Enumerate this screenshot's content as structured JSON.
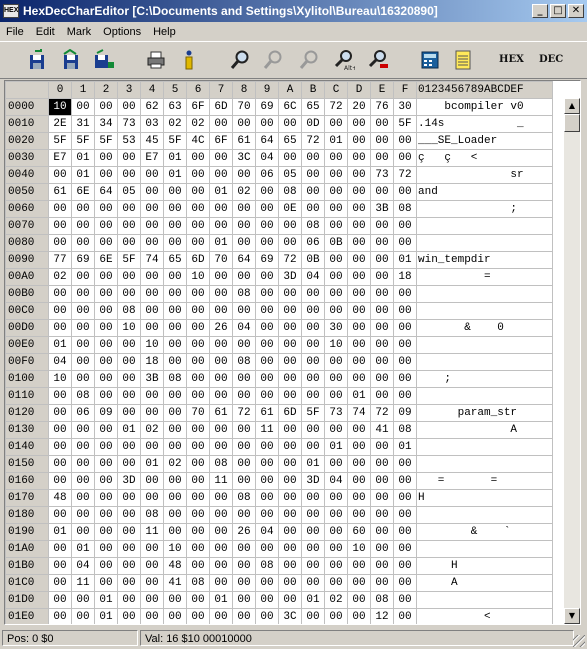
{
  "window": {
    "title": "HexDecCharEditor [C:\\Documents and Settings\\Xylitol\\Bureau\\16320890]",
    "minimize": "_",
    "maximize": "□",
    "close": "✕"
  },
  "menu": [
    "File",
    "Edit",
    "Mark",
    "Options",
    "Help"
  ],
  "toolbar": {
    "icons": [
      "save-icon",
      "save-all-icon",
      "save-selection-icon",
      "print-icon",
      "info-icon",
      "find-icon",
      "find-next-icon",
      "find-previous-icon",
      "find-replace-icon",
      "replace-icon",
      "calculator-icon",
      "notepad-icon"
    ],
    "hex_label": "HEX",
    "dec_label": "DEC"
  },
  "grid": {
    "corner": "",
    "columns": [
      "0",
      "1",
      "2",
      "3",
      "4",
      "5",
      "6",
      "7",
      "8",
      "9",
      "A",
      "B",
      "C",
      "D",
      "E",
      "F"
    ],
    "char_header": "0123456789ABCDEF",
    "selected": {
      "row": 0,
      "col": 0
    },
    "rows": [
      {
        "addr": "0000",
        "bytes": [
          "10",
          "00",
          "00",
          "00",
          "62",
          "63",
          "6F",
          "6D",
          "70",
          "69",
          "6C",
          "65",
          "72",
          "20",
          "76",
          "30"
        ],
        "text": "    bcompiler v0"
      },
      {
        "addr": "0010",
        "bytes": [
          "2E",
          "31",
          "34",
          "73",
          "03",
          "02",
          "02",
          "00",
          "00",
          "00",
          "00",
          "0D",
          "00",
          "00",
          "00",
          "5F"
        ],
        "text": ".14s           _"
      },
      {
        "addr": "0020",
        "bytes": [
          "5F",
          "5F",
          "5F",
          "53",
          "45",
          "5F",
          "4C",
          "6F",
          "61",
          "64",
          "65",
          "72",
          "01",
          "00",
          "00",
          "00"
        ],
        "text": "___SE_Loader    "
      },
      {
        "addr": "0030",
        "bytes": [
          "E7",
          "01",
          "00",
          "00",
          "E7",
          "01",
          "00",
          "00",
          "3C",
          "04",
          "00",
          "00",
          "00",
          "00",
          "00",
          "00"
        ],
        "text": "ç   ç   <       "
      },
      {
        "addr": "0040",
        "bytes": [
          "00",
          "01",
          "00",
          "00",
          "00",
          "01",
          "00",
          "00",
          "00",
          "06",
          "05",
          "00",
          "00",
          "00",
          "73",
          "72"
        ],
        "text": "              sr"
      },
      {
        "addr": "0050",
        "bytes": [
          "61",
          "6E",
          "64",
          "05",
          "00",
          "00",
          "00",
          "01",
          "02",
          "00",
          "08",
          "00",
          "00",
          "00",
          "00",
          "00"
        ],
        "text": "and             "
      },
      {
        "addr": "0060",
        "bytes": [
          "00",
          "00",
          "00",
          "00",
          "00",
          "00",
          "00",
          "00",
          "00",
          "00",
          "0E",
          "00",
          "00",
          "00",
          "3B",
          "08"
        ],
        "text": "              ; "
      },
      {
        "addr": "0070",
        "bytes": [
          "00",
          "00",
          "00",
          "00",
          "00",
          "00",
          "00",
          "00",
          "00",
          "00",
          "00",
          "08",
          "00",
          "00",
          "00",
          "00"
        ],
        "text": "                "
      },
      {
        "addr": "0080",
        "bytes": [
          "00",
          "00",
          "00",
          "00",
          "00",
          "00",
          "00",
          "01",
          "00",
          "00",
          "00",
          "06",
          "0B",
          "00",
          "00",
          "00"
        ],
        "text": "                "
      },
      {
        "addr": "0090",
        "bytes": [
          "77",
          "69",
          "6E",
          "5F",
          "74",
          "65",
          "6D",
          "70",
          "64",
          "69",
          "72",
          "0B",
          "00",
          "00",
          "00",
          "01"
        ],
        "text": "win_tempdir     "
      },
      {
        "addr": "00A0",
        "bytes": [
          "02",
          "00",
          "00",
          "00",
          "00",
          "00",
          "10",
          "00",
          "00",
          "00",
          "3D",
          "04",
          "00",
          "00",
          "00",
          "18"
        ],
        "text": "          =     "
      },
      {
        "addr": "00B0",
        "bytes": [
          "00",
          "00",
          "00",
          "00",
          "00",
          "00",
          "00",
          "00",
          "08",
          "00",
          "00",
          "00",
          "00",
          "00",
          "00",
          "00"
        ],
        "text": "                "
      },
      {
        "addr": "00C0",
        "bytes": [
          "00",
          "00",
          "00",
          "08",
          "00",
          "00",
          "00",
          "00",
          "00",
          "00",
          "00",
          "00",
          "00",
          "00",
          "00",
          "00"
        ],
        "text": "                "
      },
      {
        "addr": "00D0",
        "bytes": [
          "00",
          "00",
          "00",
          "10",
          "00",
          "00",
          "00",
          "26",
          "04",
          "00",
          "00",
          "00",
          "30",
          "00",
          "00",
          "00"
        ],
        "text": "       &    0   "
      },
      {
        "addr": "00E0",
        "bytes": [
          "01",
          "00",
          "00",
          "00",
          "10",
          "00",
          "00",
          "00",
          "00",
          "00",
          "00",
          "00",
          "10",
          "00",
          "00",
          "00"
        ],
        "text": "                "
      },
      {
        "addr": "00F0",
        "bytes": [
          "04",
          "00",
          "00",
          "00",
          "18",
          "00",
          "00",
          "00",
          "08",
          "00",
          "00",
          "00",
          "00",
          "00",
          "00",
          "00"
        ],
        "text": "                "
      },
      {
        "addr": "0100",
        "bytes": [
          "10",
          "00",
          "00",
          "00",
          "3B",
          "08",
          "00",
          "00",
          "00",
          "00",
          "00",
          "00",
          "00",
          "00",
          "00",
          "00"
        ],
        "text": "    ;           "
      },
      {
        "addr": "0110",
        "bytes": [
          "00",
          "08",
          "00",
          "00",
          "00",
          "00",
          "00",
          "00",
          "00",
          "00",
          "00",
          "00",
          "00",
          "01",
          "00",
          "00"
        ],
        "text": "                "
      },
      {
        "addr": "0120",
        "bytes": [
          "00",
          "06",
          "09",
          "00",
          "00",
          "00",
          "70",
          "61",
          "72",
          "61",
          "6D",
          "5F",
          "73",
          "74",
          "72",
          "09"
        ],
        "text": "      param_str "
      },
      {
        "addr": "0130",
        "bytes": [
          "00",
          "00",
          "00",
          "01",
          "02",
          "00",
          "00",
          "00",
          "00",
          "11",
          "00",
          "00",
          "00",
          "00",
          "41",
          "08"
        ],
        "text": "              A "
      },
      {
        "addr": "0140",
        "bytes": [
          "00",
          "00",
          "00",
          "00",
          "00",
          "00",
          "00",
          "00",
          "00",
          "00",
          "00",
          "00",
          "01",
          "00",
          "00",
          "01"
        ],
        "text": "                "
      },
      {
        "addr": "0150",
        "bytes": [
          "00",
          "00",
          "00",
          "00",
          "01",
          "02",
          "00",
          "08",
          "00",
          "00",
          "00",
          "01",
          "00",
          "00",
          "00",
          "00"
        ],
        "text": "                "
      },
      {
        "addr": "0160",
        "bytes": [
          "00",
          "00",
          "00",
          "3D",
          "00",
          "00",
          "00",
          "11",
          "00",
          "00",
          "00",
          "3D",
          "04",
          "00",
          "00",
          "00"
        ],
        "text": "   =       =    "
      },
      {
        "addr": "0170",
        "bytes": [
          "48",
          "00",
          "00",
          "00",
          "00",
          "00",
          "00",
          "00",
          "08",
          "00",
          "00",
          "00",
          "00",
          "00",
          "00",
          "00"
        ],
        "text": "H               "
      },
      {
        "addr": "0180",
        "bytes": [
          "00",
          "00",
          "00",
          "00",
          "08",
          "00",
          "00",
          "00",
          "00",
          "00",
          "00",
          "00",
          "00",
          "00",
          "00",
          "00"
        ],
        "text": "                "
      },
      {
        "addr": "0190",
        "bytes": [
          "01",
          "00",
          "00",
          "00",
          "11",
          "00",
          "00",
          "00",
          "26",
          "04",
          "00",
          "00",
          "00",
          "60",
          "00",
          "00"
        ],
        "text": "        &    `  "
      },
      {
        "addr": "01A0",
        "bytes": [
          "00",
          "01",
          "00",
          "00",
          "00",
          "10",
          "00",
          "00",
          "00",
          "00",
          "00",
          "00",
          "00",
          "10",
          "00",
          "00"
        ],
        "text": "                "
      },
      {
        "addr": "01B0",
        "bytes": [
          "00",
          "04",
          "00",
          "00",
          "00",
          "48",
          "00",
          "00",
          "00",
          "08",
          "00",
          "00",
          "00",
          "00",
          "00",
          "00"
        ],
        "text": "     H          "
      },
      {
        "addr": "01C0",
        "bytes": [
          "00",
          "11",
          "00",
          "00",
          "00",
          "41",
          "08",
          "00",
          "00",
          "00",
          "00",
          "00",
          "00",
          "00",
          "00",
          "00"
        ],
        "text": "     A          "
      },
      {
        "addr": "01D0",
        "bytes": [
          "00",
          "00",
          "01",
          "00",
          "00",
          "00",
          "00",
          "01",
          "00",
          "00",
          "00",
          "01",
          "02",
          "00",
          "08",
          "00"
        ],
        "text": "                "
      },
      {
        "addr": "01E0",
        "bytes": [
          "00",
          "00",
          "01",
          "00",
          "00",
          "00",
          "00",
          "00",
          "00",
          "00",
          "3C",
          "00",
          "00",
          "00",
          "12",
          "00"
        ],
        "text": "          <     "
      }
    ]
  },
  "status": {
    "position": "Pos: 0 $0",
    "value": "Val: 16 $10 00010000"
  },
  "colors": {
    "title_gradient_start": "#0a246a",
    "title_gradient_end": "#a6caf0",
    "face": "#d4d0c8",
    "selection": "#000000"
  }
}
